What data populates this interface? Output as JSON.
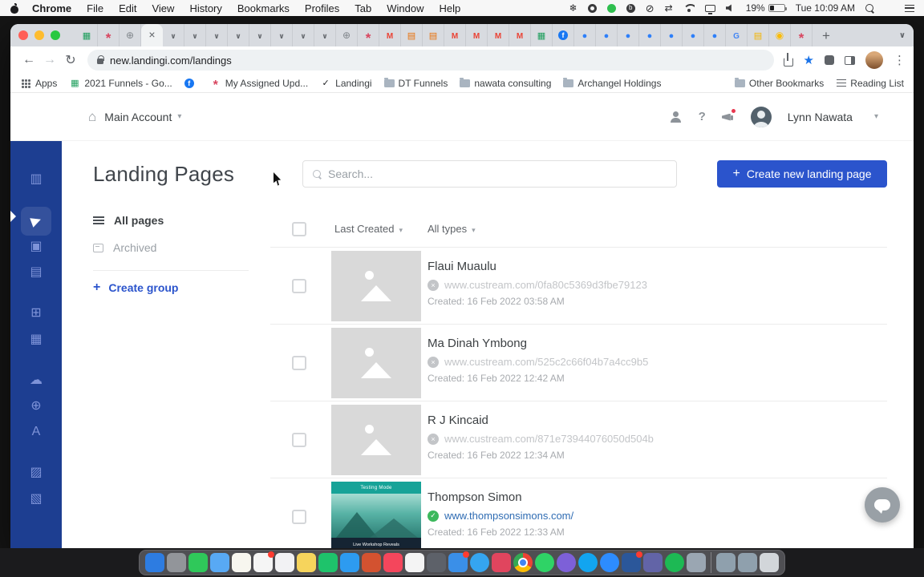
{
  "menubar": {
    "items": [
      "Chrome",
      "File",
      "Edit",
      "View",
      "History",
      "Bookmarks",
      "Profiles",
      "Tab",
      "Window",
      "Help"
    ],
    "battery": "19%",
    "clock": "Tue 10:09 AM"
  },
  "tabstrip": {
    "new_tab": "+",
    "tabs": [
      {
        "n": "sheets-tab-icon",
        "i": "sheets"
      },
      {
        "n": "clickup-tab-icon",
        "i": "pinwheel"
      },
      {
        "n": "web-tab-icon",
        "i": "globe"
      },
      {
        "n": "active-tab-close-icon",
        "i": "close",
        "cls": "active"
      },
      {
        "n": "collapsed-tab-icon",
        "i": "chev"
      },
      {
        "n": "collapsed-tab-icon",
        "i": "chev"
      },
      {
        "n": "collapsed-tab-icon",
        "i": "chev"
      },
      {
        "n": "collapsed-tab-icon",
        "i": "chev"
      },
      {
        "n": "collapsed-tab-icon",
        "i": "chev"
      },
      {
        "n": "collapsed-tab-icon",
        "i": "chev"
      },
      {
        "n": "collapsed-tab-icon",
        "i": "chev"
      },
      {
        "n": "collapsed-tab-icon",
        "i": "chev"
      },
      {
        "n": "web-tab-icon",
        "i": "globe"
      },
      {
        "n": "clickup-tab-icon",
        "i": "pinwheel"
      },
      {
        "n": "gmail-tab-icon",
        "i": "gmail"
      },
      {
        "n": "mail-tab-icon",
        "i": "envelope"
      },
      {
        "n": "mail-tab-icon",
        "i": "envelope"
      },
      {
        "n": "gmail-tab-icon",
        "i": "gmail"
      },
      {
        "n": "gmail-tab-icon",
        "i": "gmail"
      },
      {
        "n": "gmail-tab-icon",
        "i": "gmail"
      },
      {
        "n": "gmail-tab-icon",
        "i": "gmail"
      },
      {
        "n": "sheets-tab-icon",
        "i": "sheets"
      },
      {
        "n": "facebook-tab-icon",
        "i": "facebook"
      },
      {
        "n": "app-tab-icon",
        "i": "blue"
      },
      {
        "n": "app-tab-icon",
        "i": "blue"
      },
      {
        "n": "app-tab-icon",
        "i": "blue"
      },
      {
        "n": "app-tab-icon",
        "i": "blue"
      },
      {
        "n": "app-tab-icon",
        "i": "blue"
      },
      {
        "n": "app-tab-icon",
        "i": "blue"
      },
      {
        "n": "app-tab-icon",
        "i": "blue"
      },
      {
        "n": "google-tab-icon",
        "i": "google"
      },
      {
        "n": "docs-tab-icon",
        "i": "doc"
      },
      {
        "n": "photos-tab-icon",
        "i": "photos"
      },
      {
        "n": "clickup-tab-icon",
        "i": "pinwheel"
      }
    ]
  },
  "toolbar": {
    "url": "new.landingi.com/landings"
  },
  "bookmarks": {
    "items": [
      {
        "name": "apps-shortcut",
        "icon": "apps",
        "label": "Apps"
      },
      {
        "name": "bookmark-2021-funnels",
        "icon": "sheets",
        "label": "2021 Funnels - Go..."
      },
      {
        "name": "bookmark-facebook",
        "icon": "fb",
        "label": ""
      },
      {
        "name": "bookmark-my-assigned",
        "icon": "pin",
        "label": "My Assigned Upd..."
      },
      {
        "name": "bookmark-landingi",
        "icon": "landingi",
        "label": "Landingi"
      },
      {
        "name": "bookmark-folder-dt-funnels",
        "icon": "folder",
        "label": "DT Funnels"
      },
      {
        "name": "bookmark-folder-nawata-consulting",
        "icon": "folder",
        "label": "nawata consulting"
      },
      {
        "name": "bookmark-folder-archangel-holdings",
        "icon": "folder",
        "label": "Archangel Holdings"
      }
    ],
    "other_label": "Other Bookmarks",
    "reading_label": "Reading List"
  },
  "header": {
    "account": "Main Account",
    "user": "Lynn Nawata"
  },
  "sidebar": {
    "items": [
      {
        "name": "dashboard-icon",
        "glyph": "▥"
      },
      {
        "name": "landing-pages-icon",
        "glyph": "▶",
        "cls": "active"
      },
      {
        "name": "popups-icon",
        "glyph": "▣"
      },
      {
        "name": "sections-icon",
        "glyph": "▤"
      },
      {
        "name": "smart-sections-icon",
        "glyph": "⊞"
      },
      {
        "name": "leads-icon",
        "glyph": "▦"
      },
      {
        "name": "uploads-icon",
        "glyph": "☁"
      },
      {
        "name": "domains-icon",
        "glyph": "⊕"
      },
      {
        "name": "fonts-icon",
        "glyph": "A"
      },
      {
        "name": "agency-icon",
        "glyph": "▨"
      },
      {
        "name": "templates-icon",
        "glyph": "▧"
      }
    ]
  },
  "page": {
    "title": "Landing Pages",
    "search_placeholder": "Search...",
    "create_button": "Create new landing page",
    "nav_all_pages": "All pages",
    "nav_archived": "Archived",
    "nav_create_group": "Create group",
    "sort_filter": "Last Created",
    "type_filter": "All types",
    "rows": [
      {
        "title": "Flaui Muaulu",
        "url": "www.custream.com/0fa80c5369d3fbe79123",
        "created": "Created: 16 Feb 2022 03:58 AM"
      },
      {
        "title": "Ma Dinah Ymbong",
        "url": "www.custream.com/525c2c66f04b7a4cc9b5",
        "created": "Created: 16 Feb 2022 12:42 AM"
      },
      {
        "title": "R J Kincaid",
        "url": "www.custream.com/871e73944076050d504b",
        "created": "Created: 16 Feb 2022 12:34 AM"
      },
      {
        "title": "Thompson Simon",
        "url": "www.thompsonsimons.com/",
        "created": "Created: 16 Feb 2022 12:33 AM",
        "thumb_top": "Testing Mode",
        "thumb_bottom": "Live Workshop Reveals"
      }
    ]
  },
  "dock": {
    "items": [
      {
        "name": "finder-icon",
        "color": "#2d7ce1"
      },
      {
        "name": "system-preferences-icon",
        "color": "#92959a"
      },
      {
        "name": "messages-icon",
        "color": "#2fc85a"
      },
      {
        "name": "maps-icon",
        "color": "#58a9f4"
      },
      {
        "name": "notes-icon",
        "color": "#f7f6ef"
      },
      {
        "name": "calendar-icon",
        "color": "#f5f5f5",
        "badge": "on"
      },
      {
        "name": "reminders-icon",
        "color": "#f2f2f4"
      },
      {
        "name": "stickies-icon",
        "color": "#f6d45c"
      },
      {
        "name": "numbers-icon",
        "color": "#1ec36b"
      },
      {
        "name": "keynote-icon",
        "color": "#2d9bf0"
      },
      {
        "name": "powerpoint-icon",
        "color": "#d35230"
      },
      {
        "name": "music-icon",
        "color": "#f4465c"
      },
      {
        "name": "photos-icon",
        "color": "#f4f4f4"
      },
      {
        "name": "camera-icon",
        "color": "#5d6169"
      },
      {
        "name": "mail-icon",
        "color": "#3a8fe8",
        "badge": "on"
      },
      {
        "name": "safari-icon",
        "color": "#35a5f0",
        "shape": "round"
      },
      {
        "name": "clickup-icon",
        "color": "#e0455e"
      },
      {
        "name": "chrome-icon",
        "color": "",
        "shape": "round chrome"
      },
      {
        "name": "whatsapp-icon",
        "color": "#2fd366",
        "shape": "round"
      },
      {
        "name": "viber-icon",
        "color": "#7d60d8",
        "shape": "round"
      },
      {
        "name": "skype-icon",
        "color": "#12a5f0",
        "shape": "round"
      },
      {
        "name": "zoom-icon",
        "color": "#2d8cff",
        "shape": "round"
      },
      {
        "name": "word-icon",
        "color": "#2b579a",
        "badge": "on"
      },
      {
        "name": "teams-icon",
        "color": "#6264a7"
      },
      {
        "name": "spotify-icon",
        "color": "#1db954",
        "shape": "round"
      },
      {
        "name": "dropbox-icon",
        "color": "#9aa6b2"
      },
      {
        "name": "dock-divider",
        "color": "",
        "shape": "divider"
      },
      {
        "name": "downloads-folder-icon",
        "color": "#8fa0ad"
      },
      {
        "name": "documents-folder-icon",
        "color": "#8fa0ad"
      },
      {
        "name": "trash-icon",
        "color": "#d2d6da"
      }
    ]
  }
}
